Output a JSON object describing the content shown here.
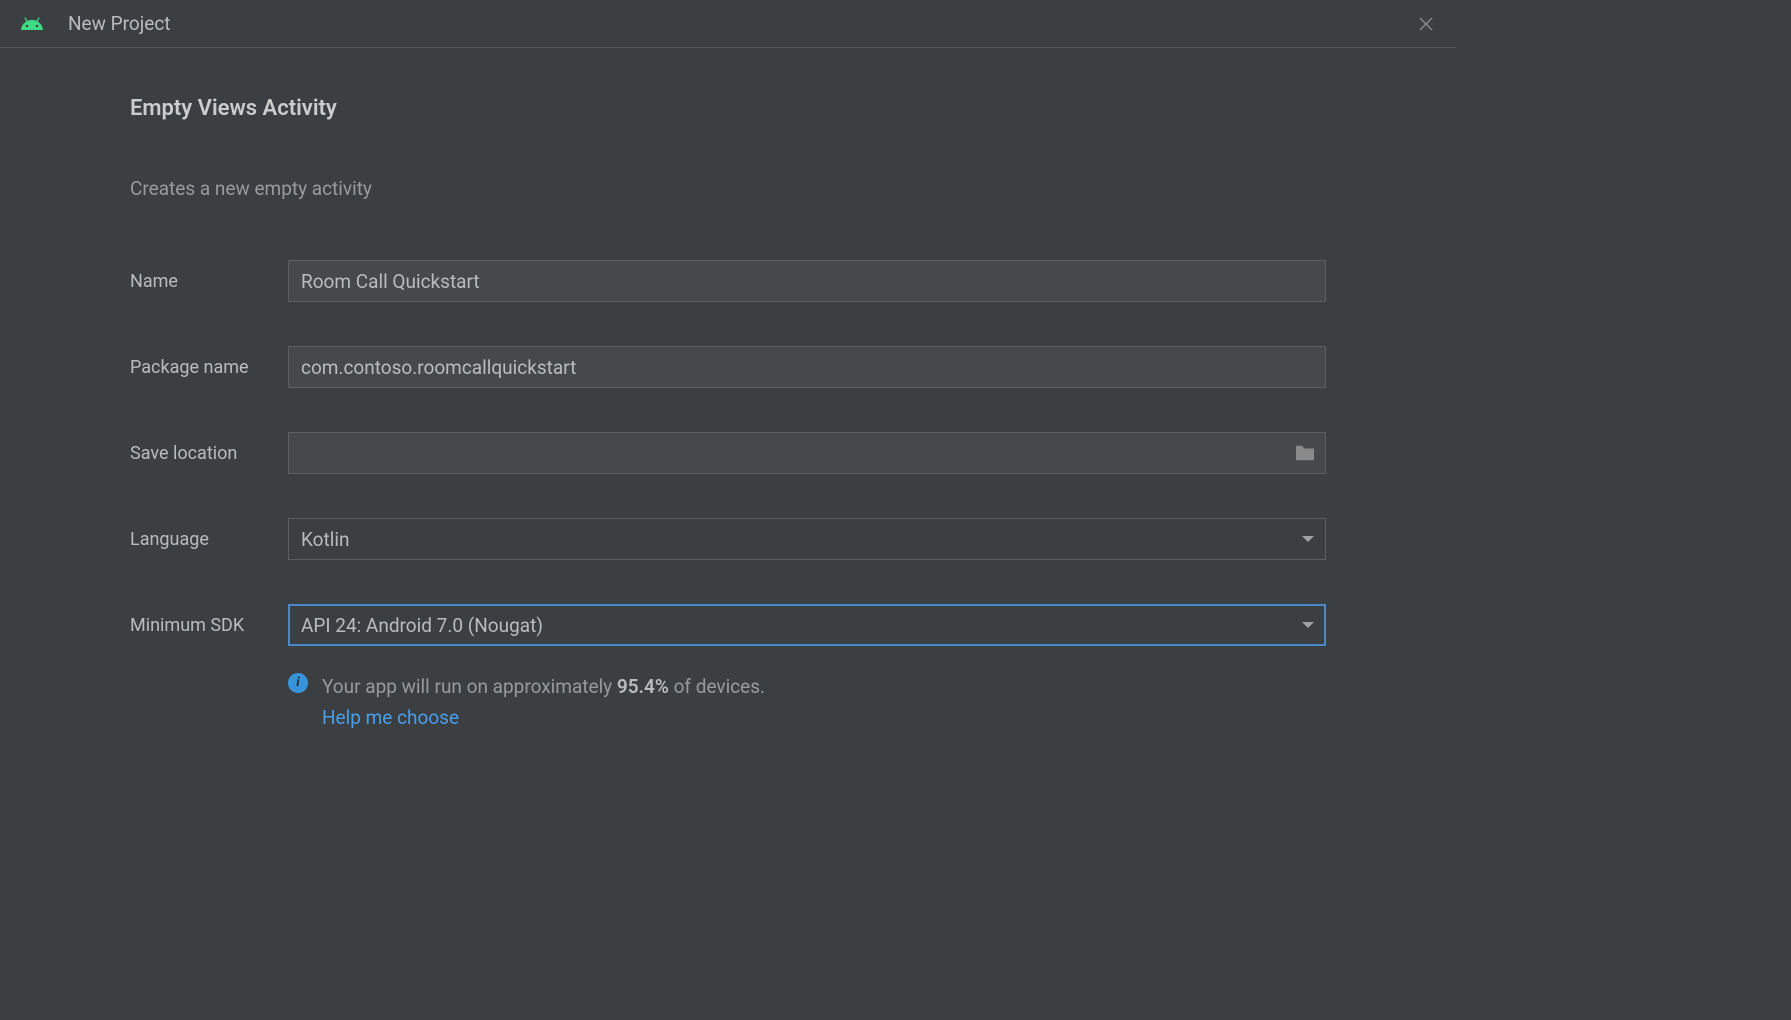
{
  "window": {
    "title": "New Project"
  },
  "page": {
    "title": "Empty Views Activity",
    "subtitle": "Creates a new empty activity"
  },
  "form": {
    "name": {
      "label": "Name",
      "value": "Room Call Quickstart"
    },
    "package": {
      "label": "Package name",
      "value": "com.contoso.roomcallquickstart"
    },
    "savelocation": {
      "label": "Save location",
      "value": ""
    },
    "language": {
      "label": "Language",
      "value": "Kotlin"
    },
    "minsdk": {
      "label": "Minimum SDK",
      "value": "API 24: Android 7.0 (Nougat)"
    }
  },
  "info": {
    "prefix": "Your app will run on approximately ",
    "percentage": "95.4%",
    "suffix": " of devices.",
    "help_link": "Help me choose"
  }
}
